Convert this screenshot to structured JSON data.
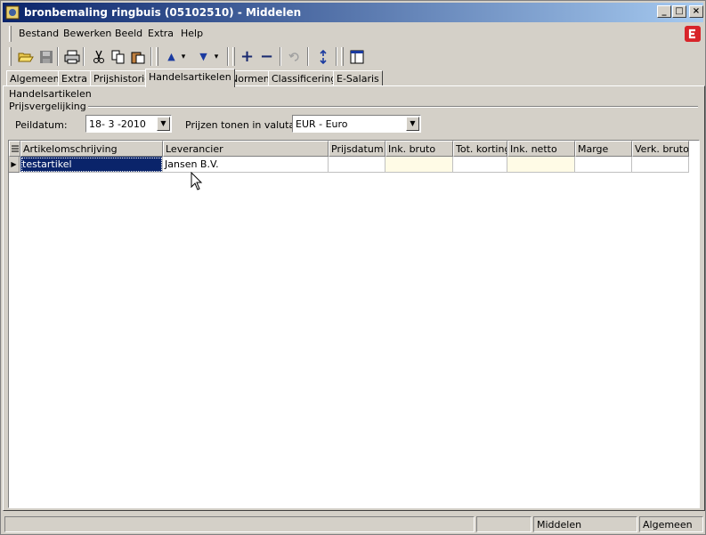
{
  "window": {
    "title": "bronbemaling ringbuis (05102510) - Middelen",
    "controls": {
      "minimize": "_",
      "maximize": "□",
      "close": "×"
    }
  },
  "menu": {
    "items": [
      "Bestand",
      "Bewerken",
      "Beeld",
      "Extra",
      "Help"
    ]
  },
  "toolbar": {
    "icons": [
      "open-icon",
      "save-icon",
      "print-icon",
      "cut-icon",
      "copy-icon",
      "paste-icon",
      "arrow-up-icon",
      "arrow-down-icon",
      "add-icon",
      "remove-icon",
      "undo-icon",
      "refresh-icon",
      "layout-icon"
    ],
    "glyphs": {
      "add": "+",
      "remove": "−",
      "up": "▲",
      "down": "▼",
      "dropdown": "▾"
    }
  },
  "tabs": {
    "items": [
      "Algemeen",
      "Extra",
      "Prijshistorie",
      "Handelsartikelen",
      "Normen",
      "Classificering",
      "E-Salaris"
    ],
    "active": "Handelsartikelen"
  },
  "section": {
    "title": "Handelsartikelen",
    "group": "Prijsvergelijking"
  },
  "filters": {
    "peildatum_label": "Peildatum:",
    "peildatum_value": "18- 3 -2010",
    "valuta_label": "Prijzen tonen in valuta:",
    "valuta_value": "EUR - Euro",
    "dropdown_glyph": "▼"
  },
  "grid": {
    "columns": [
      "Artikelomschrijving",
      "Leverancier",
      "Prijsdatum",
      "Ink. bruto",
      "Tot. korting",
      "Ink. netto",
      "Marge",
      "Verk. bruto"
    ],
    "rows": [
      {
        "artikelomschrijving": "testartikel",
        "leverancier": "Jansen B.V.",
        "prijsdatum": "",
        "ink_bruto": "",
        "tot_korting": "",
        "ink_netto": "",
        "marge": "",
        "verk_bruto": ""
      }
    ],
    "row_indicator": "▶"
  },
  "statusbar": {
    "panes": [
      "",
      "",
      "Middelen",
      "Algemeen"
    ]
  },
  "colors": {
    "title_gradient_start": "#0a246a",
    "title_gradient_end": "#a6caf0",
    "selection": "#0a246a",
    "logo": "#d8242a",
    "highlight_cell": "#fffbe6"
  }
}
